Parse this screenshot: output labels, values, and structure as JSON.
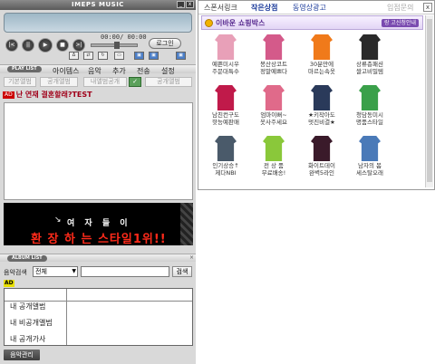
{
  "player": {
    "title": "IMEPS MUSIC",
    "window_buttons": [
      "_",
      "x"
    ],
    "time": "00:00/ 00:00",
    "login_label": "로그인",
    "controls": [
      "|<",
      "||",
      "▶",
      "■",
      ">|"
    ],
    "mini_icons": [
      "Δ",
      "⇄",
      "↻",
      "▭",
      "▣",
      "▣",
      "▣"
    ]
  },
  "playlist": {
    "header": "PLAY LIST",
    "menu": [
      "아이템스",
      "음악",
      "추가",
      "전송",
      "설정"
    ],
    "tabs": [
      "기본앨범",
      "공개앨범",
      "내앨범공개",
      "공개앨범"
    ],
    "check_label": "✓",
    "ad_badge": "AD",
    "ad_text": "난 연재 결혼할래?TEST"
  },
  "banner": {
    "subtitle": "여 자 들 이",
    "main": "환 장 하 는 스타일1위!!"
  },
  "album": {
    "header": "ALBUM LIST",
    "search_label": "음악검색",
    "search_scope": "전체",
    "search_button": "검색",
    "ad_badge": "AD",
    "items": [
      "내 공개앨범",
      "내 비공개앨범",
      "내 공개가사"
    ],
    "manage_button": "음악관리"
  },
  "shop": {
    "tabs": [
      "스폰서링크",
      "작은상점",
      "동영상광고",
      "입점문의"
    ],
    "close": "x",
    "title": "이바운 쇼핑박스",
    "link": "랑 고신청안내",
    "products": [
      {
        "name": "예쁜미시우\n주문대특수",
        "color": "#e8a0b8"
      },
      {
        "name": "봉산상코트\n정말예쁘다",
        "color": "#d45a8a"
      },
      {
        "name": "30분만에\n마르는속옷",
        "color": "#f07a1a"
      },
      {
        "name": "상류층패션\n쌀고비밀템",
        "color": "#2a2a2a"
      },
      {
        "name": "남친컨구도\n핫능예판매",
        "color": "#c01a4a"
      },
      {
        "name": "엄마이뻐~\n옷사주세요",
        "color": "#e06a8a"
      },
      {
        "name": "★키작아도\n멋진비결★",
        "color": "#2a3a5a"
      },
      {
        "name": "청담동미시\n명품스타일",
        "color": "#3aa04a"
      },
      {
        "name": "인기상승↑\n제다NBI",
        "color": "#4a5a6a"
      },
      {
        "name": "전 상 품\n무료배송!",
        "color": "#8ac83a"
      },
      {
        "name": "화이트데이\n완벽5라인",
        "color": "#3a1a2a"
      },
      {
        "name": "남자의 봄\n세스탈오래",
        "color": "#4a7ab8"
      }
    ]
  }
}
